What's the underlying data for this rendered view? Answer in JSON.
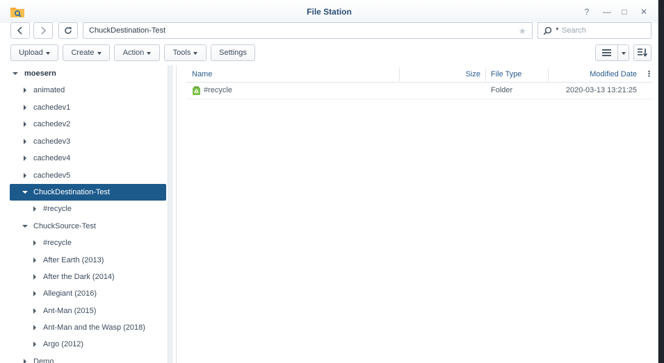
{
  "window": {
    "title": "File Station",
    "controls": [
      "?",
      "—",
      "□",
      "✕"
    ]
  },
  "nav": {
    "path": "ChuckDestination-Test",
    "search_placeholder": "Search"
  },
  "toolbar": {
    "upload": "Upload",
    "create": "Create",
    "action": "Action",
    "tools": "Tools",
    "settings": "Settings"
  },
  "tree": {
    "root": "moesern",
    "items": [
      {
        "label": "animated",
        "level": 1,
        "expanded": false
      },
      {
        "label": "cachedev1",
        "level": 1,
        "expanded": false
      },
      {
        "label": "cachedev2",
        "level": 1,
        "expanded": false
      },
      {
        "label": "cachedev3",
        "level": 1,
        "expanded": false
      },
      {
        "label": "cachedev4",
        "level": 1,
        "expanded": false
      },
      {
        "label": "cachedev5",
        "level": 1,
        "expanded": false
      },
      {
        "label": "ChuckDestination-Test",
        "level": 1,
        "expanded": true,
        "selected": true
      },
      {
        "label": "#recycle",
        "level": 2,
        "expanded": false
      },
      {
        "label": "ChuckSource-Test",
        "level": 1,
        "expanded": true
      },
      {
        "label": "#recycle",
        "level": 2,
        "expanded": false
      },
      {
        "label": "After Earth (2013)",
        "level": 2,
        "expanded": false
      },
      {
        "label": "After the Dark (2014)",
        "level": 2,
        "expanded": false
      },
      {
        "label": "Allegiant (2016)",
        "level": 2,
        "expanded": false
      },
      {
        "label": "Ant-Man (2015)",
        "level": 2,
        "expanded": false
      },
      {
        "label": "Ant-Man and the Wasp (2018)",
        "level": 2,
        "expanded": false
      },
      {
        "label": "Argo (2012)",
        "level": 2,
        "expanded": false
      },
      {
        "label": "Demo",
        "level": 1,
        "expanded": false
      }
    ]
  },
  "list": {
    "columns": {
      "name": "Name",
      "size": "Size",
      "type": "File Type",
      "modified": "Modified Date"
    },
    "rows": [
      {
        "name": "#recycle",
        "size": "",
        "type": "Folder",
        "modified": "2020-03-13 13:21:25"
      }
    ]
  },
  "colors": {
    "accent": "#1d5a8c",
    "title": "#2a4d77",
    "header_text": "#2a5d8f"
  }
}
